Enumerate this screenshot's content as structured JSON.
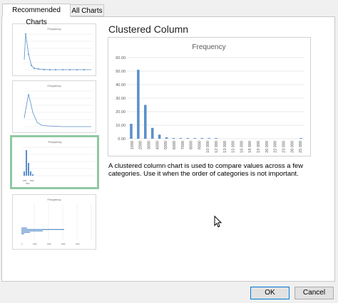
{
  "tabs": [
    {
      "label": "Recommended Charts",
      "active": true
    },
    {
      "label": "All Charts",
      "active": false
    }
  ],
  "selected_chart": {
    "name": "Clustered Column",
    "description": "A clustered column chart is used to compare values across a few categories. Use it when the order of categories is not important."
  },
  "thumbnails": [
    {
      "name": "scatter-with-smooth-lines-and-markers",
      "title": "Frequency",
      "selected": false
    },
    {
      "name": "scatter-with-smooth-lines",
      "title": "Frequency",
      "selected": false
    },
    {
      "name": "clustered-column",
      "title": "Frequency",
      "selected": true
    },
    {
      "name": "clustered-bar",
      "title": "Frequency",
      "selected": false
    }
  ],
  "chart_data": {
    "type": "bar",
    "title": "Frequency",
    "xlabel": "",
    "ylabel": "",
    "categories": [
      "1000",
      "2000",
      "3000",
      "4000",
      "5000",
      "6000",
      "7000",
      "8000",
      "9000",
      "10000",
      "11000",
      "12000",
      "13000",
      "14000",
      "15000",
      "16000",
      "17000",
      "18000",
      "19000",
      "20000",
      "21000",
      "22000",
      "23000",
      "24000",
      "25000"
    ],
    "tick_labels_shown": [
      "1000",
      "2000",
      "3000",
      "4000",
      "5000",
      "6000",
      "7000",
      "8000",
      "9000",
      "10 000",
      "12 000",
      "13 000",
      "15 000",
      "16 000",
      "18 000",
      "19 000",
      "20 000",
      "22 000",
      "23 000",
      "26 000",
      "25 000"
    ],
    "values": [
      11,
      51,
      25,
      8,
      3,
      1,
      0.5,
      0.5,
      0.5,
      0.5,
      0.5,
      0.5,
      0.5,
      0,
      0,
      0,
      0,
      0,
      0,
      0,
      0,
      0,
      0,
      0,
      0.5
    ],
    "ylim": [
      0,
      60
    ],
    "yticks": [
      "0.00",
      "10.00",
      "20.00",
      "30.00",
      "40.00",
      "50.00",
      "60.00"
    ],
    "bar_color": "#5b8fcb",
    "grid": true
  },
  "buttons": {
    "ok": "OK",
    "cancel": "Cancel"
  }
}
